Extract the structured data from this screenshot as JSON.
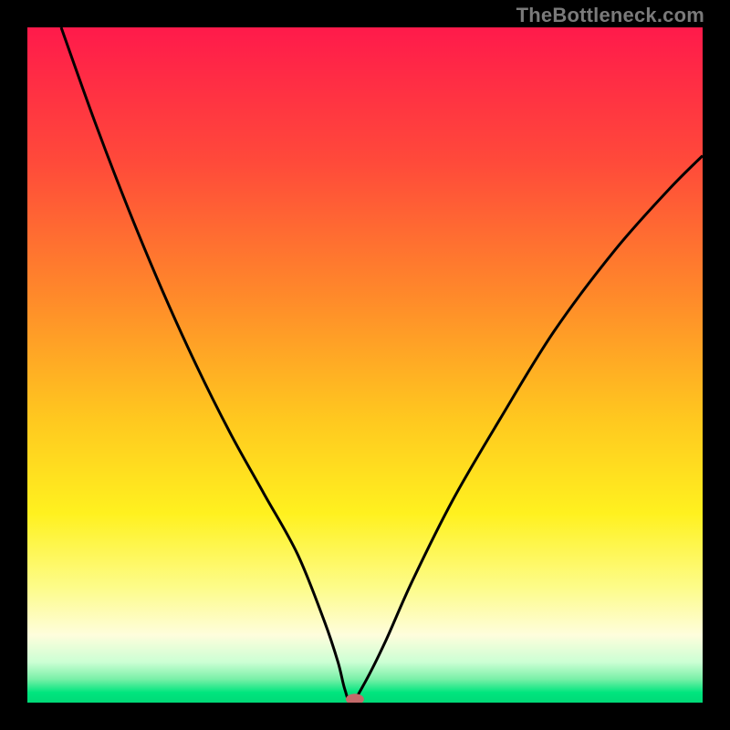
{
  "watermark": {
    "text": "TheBottleneck.com"
  },
  "chart_data": {
    "type": "line",
    "title": "",
    "xlabel": "",
    "ylabel": "",
    "xlim": [
      0,
      100
    ],
    "ylim": [
      0,
      100
    ],
    "grid": false,
    "legend": false,
    "background": {
      "type": "vertical-gradient",
      "stops": [
        {
          "pos": 0.0,
          "color": "#ff1a4b"
        },
        {
          "pos": 0.2,
          "color": "#ff4a3a"
        },
        {
          "pos": 0.4,
          "color": "#ff8a2a"
        },
        {
          "pos": 0.58,
          "color": "#ffc81f"
        },
        {
          "pos": 0.72,
          "color": "#fff11f"
        },
        {
          "pos": 0.83,
          "color": "#fdfc8a"
        },
        {
          "pos": 0.9,
          "color": "#fefddc"
        },
        {
          "pos": 0.94,
          "color": "#ccffd4"
        },
        {
          "pos": 0.965,
          "color": "#7af0a8"
        },
        {
          "pos": 0.985,
          "color": "#00e57e"
        },
        {
          "pos": 1.0,
          "color": "#00d977"
        }
      ]
    },
    "series": [
      {
        "name": "bottleneck-curve",
        "color": "#000000",
        "x": [
          5,
          10,
          15,
          20,
          25,
          30,
          35,
          40,
          44,
          46,
          47,
          48,
          50,
          53,
          57,
          63,
          70,
          78,
          87,
          95,
          100
        ],
        "y": [
          100,
          86,
          73,
          61,
          50,
          40,
          31,
          22,
          12,
          6,
          2,
          0,
          3,
          9,
          18,
          30,
          42,
          55,
          67,
          76,
          81
        ]
      }
    ],
    "markers": [
      {
        "name": "optimal-point",
        "x": 48.5,
        "y": 0.5,
        "color": "#c46a6a",
        "rx": 10,
        "ry": 6
      }
    ]
  }
}
